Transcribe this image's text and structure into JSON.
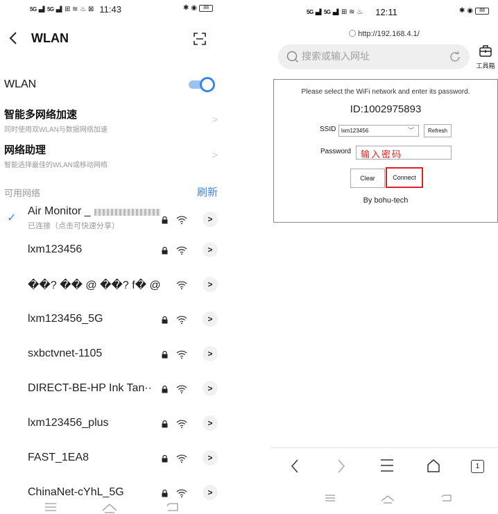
{
  "left": {
    "status": {
      "time": "11:43",
      "sig1": "5G",
      "sig2": "5G",
      "icons": "⊞ ≋ ♨ ⊠"
    },
    "header": {
      "title": "WLAN"
    },
    "wlan_toggle": {
      "label": "WLAN",
      "enabled": true
    },
    "options": [
      {
        "title": "智能多网络加速",
        "subtitle": "同时使用双WLAN与数据网络加速"
      },
      {
        "title": "网络助理",
        "subtitle": "智能选择最佳的WLAN或移动网络"
      }
    ],
    "available_label": "可用网络",
    "refresh_label": "刷新",
    "networks": [
      {
        "name": "Air Monitor _",
        "status": "已连接（点击可快速分享）",
        "connected": true,
        "locked": true
      },
      {
        "name": "lxm123456",
        "status": "",
        "connected": false,
        "locked": true
      },
      {
        "name": "��?  �� @ ��?  f� @",
        "status": "",
        "connected": false,
        "locked": false
      },
      {
        "name": "lxm123456_5G",
        "status": "",
        "connected": false,
        "locked": true
      },
      {
        "name": "sxbctvnet-1105",
        "status": "",
        "connected": false,
        "locked": true
      },
      {
        "name": "DIRECT-BE-HP Ink Tan··",
        "status": "",
        "connected": false,
        "locked": true
      },
      {
        "name": "lxm123456_plus",
        "status": "",
        "connected": false,
        "locked": true
      },
      {
        "name": "FAST_1EA8",
        "status": "",
        "connected": false,
        "locked": true
      },
      {
        "name": "ChinaNet-cYhL_5G",
        "status": "",
        "connected": false,
        "locked": true
      }
    ]
  },
  "right": {
    "status": {
      "time": "12:11",
      "sig1": "5G",
      "sig2": "5G"
    },
    "url": "http://192.168.4.1/",
    "search_placeholder": "搜索或输入网址",
    "toolbox_label": "工具箱",
    "panel": {
      "instruction": "Please select the WiFi network and enter its password.",
      "id_text": "ID:1002975893",
      "ssid_label": "SSID",
      "ssid_value": "lxm123456",
      "refresh_button": "Refresh",
      "password_label": "Password",
      "password_annotation": "输入密码",
      "clear_button": "Clear",
      "connect_button": "Connect",
      "footer": "By bohu-tech"
    },
    "tab_count": "1"
  },
  "colors": {
    "accent": "#3a86e8",
    "annotation": "#e02020"
  }
}
